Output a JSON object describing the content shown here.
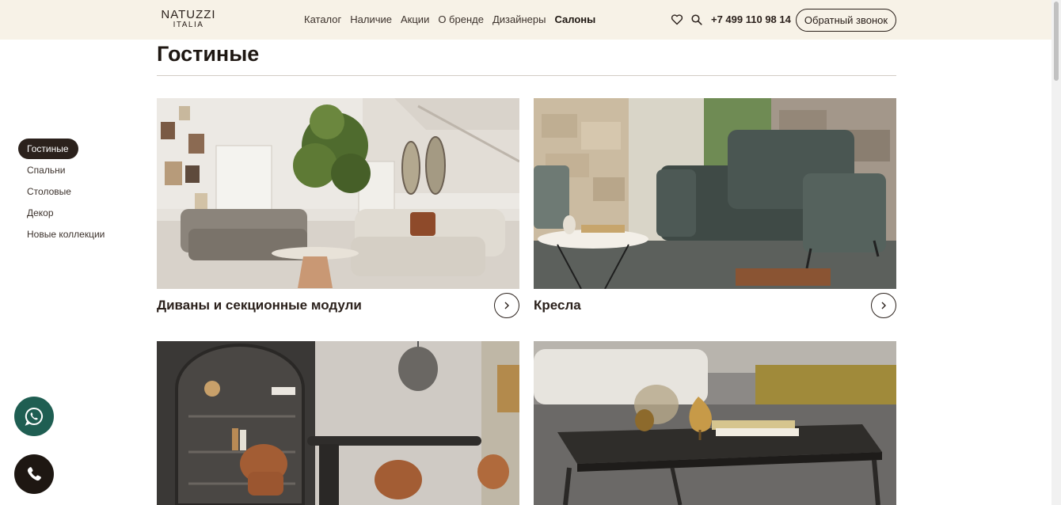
{
  "header": {
    "logo_line1": "NATUZZI",
    "logo_line2": "ITALIA",
    "nav": [
      "Каталог",
      "Наличие",
      "Акции",
      "О бренде",
      "Дизайнеры",
      "Салоны"
    ],
    "active_nav": "Салоны",
    "phone": "+7 499 110 98 14",
    "callback_label": "Обратный звонок",
    "icons": [
      "heart-icon",
      "search-icon"
    ]
  },
  "page": {
    "title": "Гостиные"
  },
  "sidebar": {
    "items": [
      {
        "label": "Гостиные",
        "active": true
      },
      {
        "label": "Спальни",
        "active": false
      },
      {
        "label": "Столовые",
        "active": false
      },
      {
        "label": "Декор",
        "active": false
      },
      {
        "label": "Новые коллекции",
        "active": false
      }
    ]
  },
  "cards": [
    {
      "title": "Диваны и секционные модули",
      "image": "living room with grey modular sofas and plant"
    },
    {
      "title": "Кресла",
      "image": "dark green armchair in stone-walled room"
    },
    {
      "title": "",
      "image": "dining area with arched shelving and brown chairs"
    },
    {
      "title": "",
      "image": "dark coffee table with decorative objects"
    }
  ],
  "floating": {
    "icons": [
      "whatsapp-icon",
      "phone-icon"
    ]
  },
  "colors": {
    "header_bg": "#f7f2e7",
    "brand_dark": "#2b211c",
    "whatsapp_green": "#1f5e52"
  }
}
